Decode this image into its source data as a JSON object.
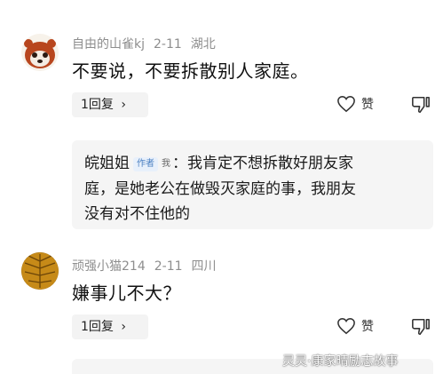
{
  "comments": [
    {
      "username": "自由的山雀kj",
      "date": "2-11",
      "location": "湖北",
      "text": "不要说，不要拆散别人家庭。",
      "reply_label": "1回复",
      "like_label": "赞",
      "avatar_icon": "red-panda-avatar"
    },
    {
      "username": "顽强小猫214",
      "date": "2-11",
      "location": "四川",
      "text": "嫌事儿不大？",
      "reply_label": "1回复",
      "like_label": "赞",
      "avatar_icon": "leaf-avatar"
    }
  ],
  "reply": {
    "author": "皖姐姐",
    "author_tag": "作者",
    "self_tag": "我",
    "separator": "：",
    "lines": [
      "我肯定不想拆散好朋友家",
      "庭，是她老公在做毁灭家庭的事，我朋友",
      "没有对不住他的"
    ]
  },
  "watermark": "灵灵·康家晴励志故事",
  "colors": {
    "meta": "#8e8e8e",
    "tag_bg": "#e8f0fb",
    "tag_text": "#4a7fc1",
    "reply_bg": "#f5f5f5"
  }
}
